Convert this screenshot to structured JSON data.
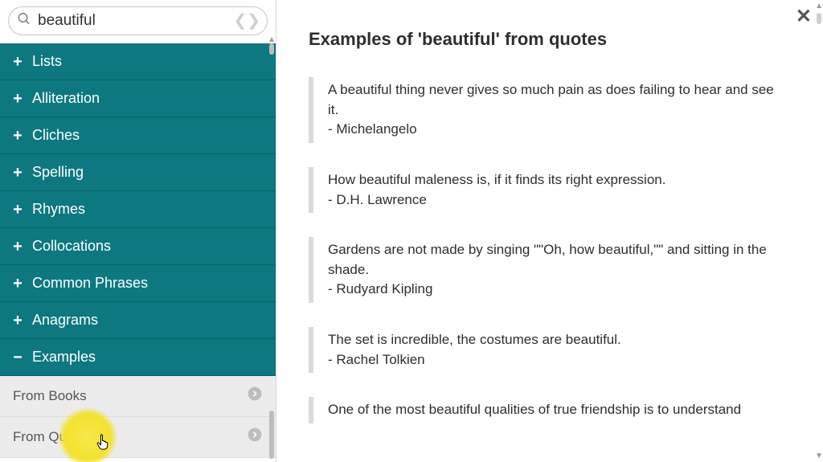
{
  "search": {
    "value": "beautiful",
    "placeholder": ""
  },
  "sidebar": {
    "items": [
      {
        "label": "Lists",
        "icon": "plus"
      },
      {
        "label": "Alliteration",
        "icon": "plus"
      },
      {
        "label": "Cliches",
        "icon": "plus"
      },
      {
        "label": "Spelling",
        "icon": "plus"
      },
      {
        "label": "Rhymes",
        "icon": "plus"
      },
      {
        "label": "Collocations",
        "icon": "plus"
      },
      {
        "label": "Common Phrases",
        "icon": "plus"
      },
      {
        "label": "Anagrams",
        "icon": "plus"
      },
      {
        "label": "Examples",
        "icon": "minus"
      }
    ],
    "sub_items": [
      {
        "label": "From Books"
      },
      {
        "label": "From Quotes"
      }
    ]
  },
  "content": {
    "heading": "Examples of 'beautiful' from quotes",
    "quotes": [
      {
        "text": "A beautiful thing never gives so much pain as does failing to hear and see it.",
        "author": "- Michelangelo"
      },
      {
        "text": "How beautiful maleness is, if it finds its right expression.",
        "author": "- D.H. Lawrence"
      },
      {
        "text": "Gardens are not made by singing \"\"Oh, how beautiful,\"\" and sitting in the shade.",
        "author": "- Rudyard Kipling"
      },
      {
        "text": "The set is incredible, the costumes are beautiful.",
        "author": "- Rachel Tolkien"
      },
      {
        "text": "One of the most beautiful qualities of true friendship is to understand",
        "author": ""
      }
    ]
  },
  "icons": {
    "plus": "+",
    "minus": "−",
    "close": "✕"
  }
}
